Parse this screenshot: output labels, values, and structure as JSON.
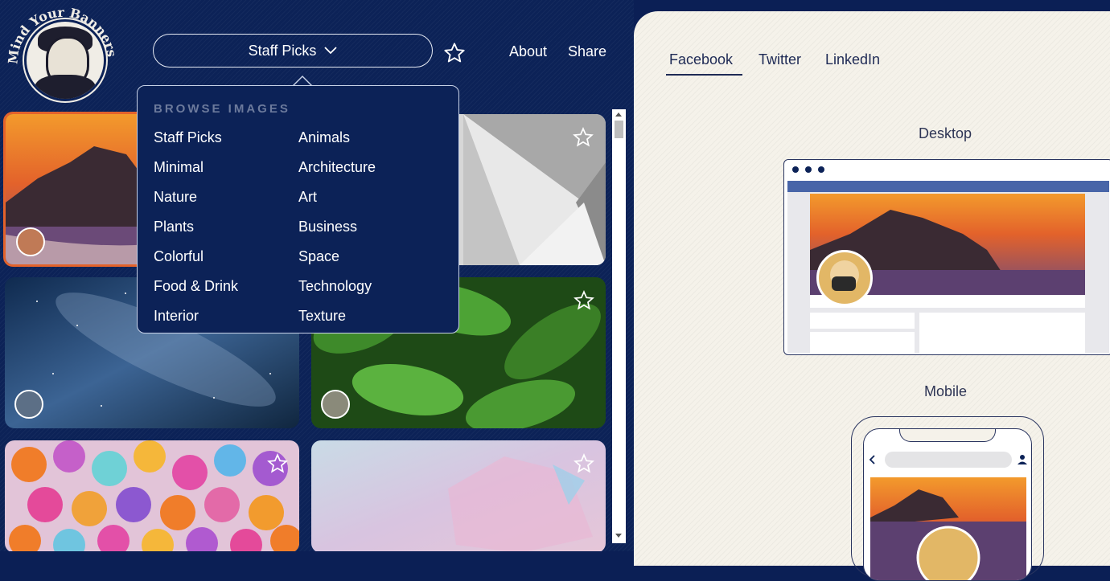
{
  "logo": {
    "text": "Mind Your Banners"
  },
  "header": {
    "dropdown_label": "Staff Picks",
    "nav": {
      "about": "About",
      "share": "Share"
    }
  },
  "menu": {
    "title": "BROWSE IMAGES",
    "col1": [
      "Staff Picks",
      "Minimal",
      "Nature",
      "Plants",
      "Colorful",
      "Food & Drink",
      "Interior"
    ],
    "col2": [
      "Animals",
      "Architecture",
      "Art",
      "Business",
      "Space",
      "Technology",
      "Texture"
    ]
  },
  "preview": {
    "tabs": [
      "Facebook",
      "Twitter",
      "LinkedIn"
    ],
    "active_tab": "Facebook",
    "desktop_label": "Desktop",
    "mobile_label": "Mobile"
  },
  "icons": {
    "favorite": "star-outline-icon",
    "dropdown": "chevron-down-icon",
    "back": "chevron-left-icon",
    "profile": "user-icon"
  },
  "colors": {
    "navy": "#0c2257",
    "panel": "#f5f2ea",
    "selected_border": "#e3622b",
    "facebook_bar": "#4865a8"
  }
}
